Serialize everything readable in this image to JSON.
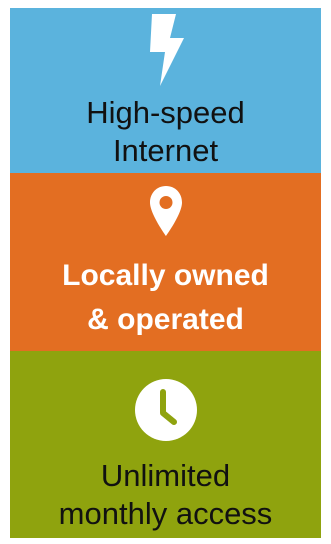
{
  "colors": {
    "blue_panel": "#5bb3dd",
    "orange_panel": "#e36e22",
    "green_panel": "#8fa30e",
    "text_dark": "#111111",
    "text_light": "#ffffff",
    "icon_color": "#ffffff"
  },
  "features": [
    {
      "icon": "lightning-bolt-icon",
      "line1": "High-speed",
      "line2": "Internet"
    },
    {
      "icon": "location-pin-icon",
      "line1": "Locally owned",
      "line2": "& operated"
    },
    {
      "icon": "clock-icon",
      "line1": "Unlimited",
      "line2": "monthly access"
    }
  ]
}
